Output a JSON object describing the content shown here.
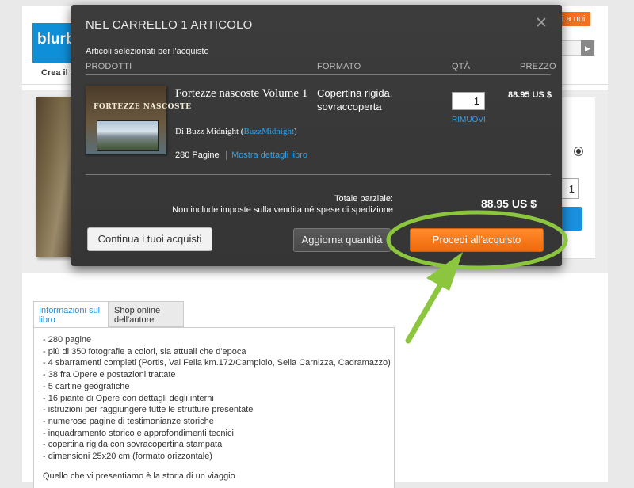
{
  "site": {
    "logo_text": "blurb",
    "crea_text": "Crea il t",
    "join_label": "ti a noi",
    "search_btn_icon": "chevron-right-icon",
    "qty_value": "1"
  },
  "modal": {
    "title": "NEL CARRELLO 1 ARTICOLO",
    "subhead": "Articoli selezionati per l'acquisto",
    "columns": {
      "products": "PRODOTTI",
      "format": "FORMATO",
      "qty": "QTÀ",
      "price": "PREZZO"
    },
    "item": {
      "cover_title": "FORTEZZE NASCOSTE",
      "title": "Fortezze nascoste Volume 1",
      "author_prefix": "Di Buzz Midnight (",
      "author_handle": "BuzzMidnight",
      "author_suffix": ")",
      "pages": "280 Pagine",
      "details_link": "Mostra dettagli libro",
      "format": "Copertina rigida, sovraccoperta",
      "qty": "1",
      "remove": "RIMUOVI",
      "price": "88.95 US $"
    },
    "subtotal_label": "Totale parziale:",
    "subtotal_note": "Non include imposte sulla vendita né spese di spedizione",
    "subtotal_value": "88.95 US $",
    "buttons": {
      "continue": "Continua i tuoi acquisti",
      "update": "Aggiorna quantità",
      "checkout": "Procedi all'acquisto"
    }
  },
  "info": {
    "tabs": [
      "Informazioni sul libro",
      "Shop online dell'autore"
    ],
    "lines": [
      "- 280 pagine",
      "- più di 350 fotografie a colori, sia attuali che d'epoca",
      "- 4 sbarramenti completi (Portis, Val Fella km.172/Campiolo, Sella Carnizza, Cadramazzo)",
      "- 38 fra Opere e postazioni trattate",
      "- 5 cartine geografiche",
      "- 16 piante di Opere con dettagli degli interni",
      "- istruzioni per raggiungere tutte le strutture presentate",
      "- numerose pagine di testimonianze storiche",
      "- inquadramento storico e approfondimenti tecnici",
      "- copertina rigida con sovracopertina stampata",
      "- dimensioni 25x20 cm (formato orizzontale)"
    ],
    "tail": "Quello che vi presentiamo è la storia di un viaggio"
  },
  "colors": {
    "accent": "#f37021",
    "link": "#29a3ee",
    "highlight": "#8cc63f"
  }
}
